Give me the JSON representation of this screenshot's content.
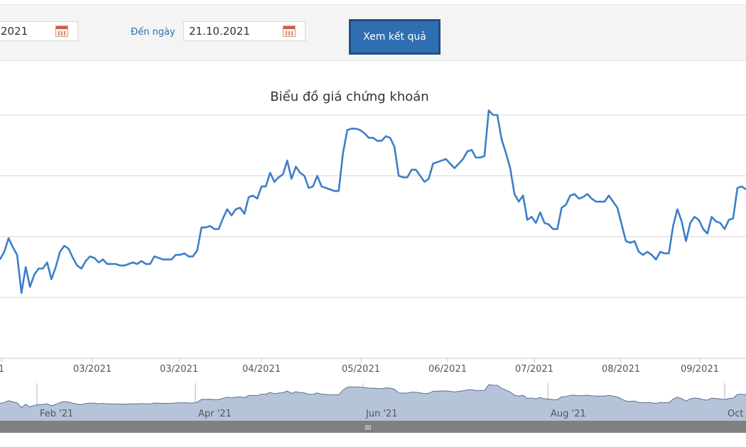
{
  "toolbar": {
    "from_date_value": "2021",
    "to_label": "Đến ngày",
    "to_date_value": "21.10.2021",
    "submit_label": "Xem kết quả"
  },
  "colors": {
    "line": "#3d7ec8",
    "grid": "#d8d8d8",
    "navigator_fill": "#b6c4d9",
    "navigator_stroke": "#5b6f92",
    "scrollbar": "#808080",
    "axis_text": "#555555",
    "title_text": "#333333"
  },
  "chart_data": {
    "type": "line",
    "title": "Biểu đồ giá chứng khoán",
    "x_tick_labels": [
      "1",
      "03/2021",
      "03/2021",
      "04/2021",
      "05/2021",
      "06/2021",
      "07/2021",
      "08/2021",
      "09/2021"
    ],
    "grid": true,
    "series": [
      {
        "values": [
          65,
          70,
          79,
          73,
          68,
          43,
          60,
          47,
          55,
          59,
          59,
          63,
          52,
          60,
          70,
          74,
          72,
          66,
          61,
          59,
          64,
          67,
          66,
          63,
          65,
          62,
          62,
          62,
          61,
          61,
          62,
          63,
          62,
          64,
          62,
          62,
          67,
          66,
          65,
          65,
          65,
          68,
          68,
          69,
          67,
          67,
          71,
          86,
          86,
          87,
          85,
          85,
          92,
          98,
          94,
          98,
          99,
          95,
          106,
          107,
          105,
          113,
          113,
          122,
          116,
          119,
          121,
          130,
          118,
          126,
          122,
          120,
          112,
          113,
          120,
          113,
          112,
          111,
          110,
          110,
          135,
          150,
          151,
          151,
          150,
          148,
          145,
          145,
          143,
          143,
          146,
          145,
          139,
          120,
          119,
          119,
          124,
          124,
          120,
          116,
          118,
          128,
          129,
          130,
          131,
          128,
          125,
          128,
          131,
          136,
          137,
          132,
          132,
          133,
          163,
          160,
          160,
          144,
          135,
          125,
          108,
          103,
          107,
          91,
          93,
          89,
          96,
          89,
          88,
          85,
          85,
          99,
          101,
          107,
          108,
          105,
          106,
          108,
          105,
          103,
          103,
          103,
          107,
          103,
          99,
          88,
          77,
          76,
          77,
          70,
          68,
          70,
          68,
          65,
          70,
          69,
          69,
          87,
          98,
          90,
          77,
          89,
          93,
          91,
          85,
          82,
          93,
          90,
          89,
          85,
          91,
          92,
          112,
          113,
          111
        ]
      }
    ],
    "navigator": {
      "labels": [
        "Feb '21",
        "Apr '21",
        "Jun '21",
        "Aug '21",
        "Oct"
      ]
    }
  },
  "scrollbar": {
    "grip_label": "III"
  }
}
